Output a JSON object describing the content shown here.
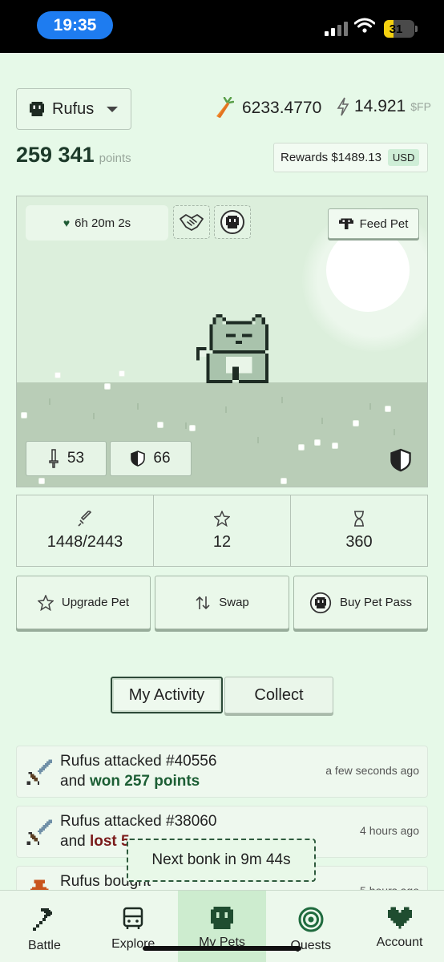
{
  "status_bar": {
    "time": "19:35",
    "battery": "31",
    "battery_level": 0.31
  },
  "header": {
    "pet_name": "Rufus",
    "carrots": "6233.4770",
    "fp_amount": "14.921",
    "fp_unit": "$FP",
    "points_value": "259 341",
    "points_label": "points",
    "rewards_label": "Rewards $1489.13",
    "rewards_currency": "USD"
  },
  "scene": {
    "timer": "6h 20m 2s",
    "feed_label": "Feed Pet",
    "attack": "53",
    "defense": "66"
  },
  "stats": [
    {
      "icon": "sword-icon",
      "value": "1448/2443"
    },
    {
      "icon": "star-icon",
      "value": "12"
    },
    {
      "icon": "hourglass-icon",
      "value": "360"
    }
  ],
  "actions": {
    "upgrade": "Upgrade Pet",
    "swap": "Swap",
    "buy_pass": "Buy Pet Pass"
  },
  "tabs": {
    "activity": "My Activity",
    "collect": "Collect"
  },
  "activity": [
    {
      "icon": "sword-icon",
      "name": "Rufus",
      "action": " attacked #40556",
      "prefix": "and ",
      "result": "won 257 points",
      "outcome": "won",
      "time": "a few seconds ago"
    },
    {
      "icon": "sword-icon",
      "name": "Rufus",
      "action": " attacked #38060",
      "prefix": "and ",
      "result": "lost 5",
      "outcome": "lost",
      "time": "4 hours ago"
    },
    {
      "icon": "potion-icon",
      "name": "Rufus",
      "action": " bought",
      "time": "5 hours ago"
    }
  ],
  "toast": "Next bonk in 9m 44s",
  "nav": [
    "Battle",
    "Explore",
    "My Pets",
    "Quests",
    "Account"
  ],
  "colors": {
    "background": "#e6f9e8",
    "accent_dark": "#1d3a2a",
    "won": "#1c5e34",
    "lost": "#7a1a1a",
    "time_pill": "#1e7cf0",
    "battery": "#f4d00f"
  }
}
